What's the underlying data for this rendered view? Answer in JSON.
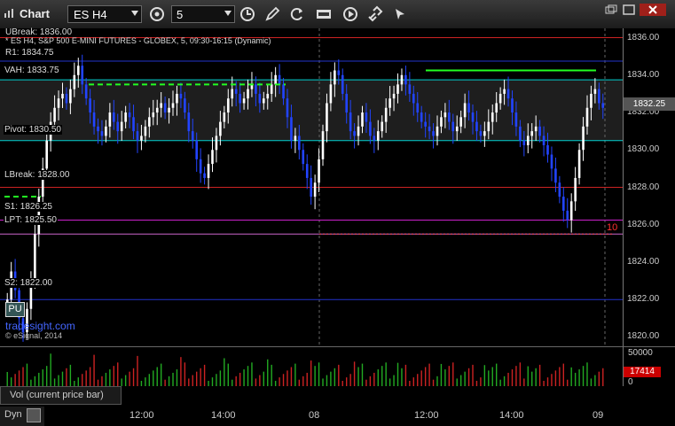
{
  "window": {
    "title": "Chart",
    "symbol": "ES H4",
    "interval": "5",
    "toolbar_icons": [
      "interval-menu-icon",
      "cursor-clock-icon",
      "draw-pencil-icon",
      "refresh-icon",
      "studies-icon",
      "play-icon",
      "link-icon"
    ],
    "window_icons": [
      "restore-icon",
      "maximize-icon",
      "close-icon"
    ]
  },
  "header": {
    "ubreak": "UBreak: 1836.00",
    "description": "* ES H4, S&P 500 E-MINI FUTURES - GLOBEX, 5, 09:30-16:15 (Dynamic)",
    "r1": "R1: 1834.75"
  },
  "levels": {
    "vah": "VAH: 1833.75",
    "pivot": "Pivot: 1830.50",
    "lbreak": "LBreak: 1828.00",
    "s1": "S1: 1826.25",
    "lpt": "LPT: 1825.50",
    "s2": "S2: 1822.00"
  },
  "badge": "PU",
  "watermark": "tradesight.com",
  "copyright": "© eSignal, 2014",
  "current_price": "1832.25",
  "volume": {
    "label": "Vol (current price bar)",
    "current": "17414",
    "tick_top": "50000",
    "tick_zero": "0"
  },
  "red_marker": "10",
  "footer": {
    "mode": "Dyn"
  },
  "colors": {
    "up_bar": "#ffffff",
    "down_bar": "#2244ff",
    "ubreak_line": "#cc2222",
    "r1_line": "#2233cc",
    "vah_line": "#00d0d0",
    "pivot_line": "#00d0d0",
    "lbreak_line": "#cc2222",
    "s1_line": "#cc22cc",
    "lpt_line": "#cc66cc",
    "s2_line": "#2233cc",
    "value_area_fill": "#1e1e1e",
    "volume_up": "#22aa22",
    "volume_down": "#cc2222"
  },
  "chart_data": {
    "type": "candlestick",
    "title": "ES H4, S&P 500 E-MINI FUTURES - GLOBEX, 5, 09:30-16:15 (Dynamic)",
    "ylim": [
      1819.5,
      1836.5
    ],
    "yticks": [
      "1836.00",
      "1834.00",
      "1832.00",
      "1830.00",
      "1828.00",
      "1826.00",
      "1824.00",
      "1822.00",
      "1820.00"
    ],
    "xticks": [
      "12:00",
      "14:00",
      "08",
      "12:00",
      "14:00",
      "09"
    ],
    "levels": [
      {
        "name": "UBreak",
        "value": 1836.0
      },
      {
        "name": "R1",
        "value": 1834.75
      },
      {
        "name": "VAH",
        "value": 1833.75
      },
      {
        "name": "Pivot",
        "value": 1830.5
      },
      {
        "name": "LBreak",
        "value": 1828.0
      },
      {
        "name": "S1",
        "value": 1826.25
      },
      {
        "name": "LPT",
        "value": 1825.5
      },
      {
        "name": "S2",
        "value": 1822.0
      }
    ],
    "closes": [
      1822.0,
      1823.5,
      1822.5,
      1821.0,
      1820.25,
      1821.5,
      1823.0,
      1825.5,
      1827.5,
      1829.0,
      1830.5,
      1831.5,
      1832.25,
      1832.75,
      1833.0,
      1832.5,
      1833.25,
      1834.0,
      1834.5,
      1833.5,
      1832.75,
      1832.0,
      1831.25,
      1831.0,
      1830.75,
      1831.25,
      1832.0,
      1831.5,
      1831.0,
      1831.5,
      1832.0,
      1831.75,
      1831.0,
      1830.5,
      1830.75,
      1831.25,
      1831.75,
      1832.0,
      1832.25,
      1832.5,
      1832.0,
      1832.25,
      1832.5,
      1833.0,
      1832.75,
      1832.0,
      1831.0,
      1830.5,
      1829.5,
      1828.75,
      1828.5,
      1829.25,
      1830.0,
      1830.75,
      1831.5,
      1832.0,
      1832.75,
      1833.25,
      1833.0,
      1832.5,
      1832.75,
      1833.25,
      1833.5,
      1833.0,
      1832.5,
      1832.75,
      1833.0,
      1833.5,
      1834.0,
      1833.5,
      1832.75,
      1831.75,
      1830.5,
      1830.75,
      1830.0,
      1829.25,
      1828.5,
      1827.5,
      1828.25,
      1829.5,
      1831.0,
      1832.5,
      1833.5,
      1834.25,
      1834.0,
      1833.0,
      1832.0,
      1831.0,
      1830.75,
      1831.25,
      1832.0,
      1831.5,
      1830.75,
      1830.5,
      1831.0,
      1831.5,
      1832.25,
      1832.75,
      1833.0,
      1833.5,
      1834.0,
      1833.5,
      1833.0,
      1832.5,
      1832.0,
      1831.5,
      1831.25,
      1831.0,
      1830.75,
      1831.25,
      1831.75,
      1832.0,
      1831.5,
      1831.0,
      1831.25,
      1831.75,
      1832.5,
      1832.0,
      1831.5,
      1831.0,
      1830.75,
      1831.0,
      1831.5,
      1832.0,
      1832.5,
      1833.0,
      1833.25,
      1832.75,
      1832.0,
      1831.25,
      1830.5,
      1830.25,
      1830.75,
      1831.0,
      1831.25,
      1830.75,
      1830.25,
      1829.75,
      1829.0,
      1828.25,
      1827.5,
      1826.75,
      1826.25,
      1827.25,
      1828.5,
      1830.0,
      1831.25,
      1832.25,
      1833.0,
      1833.25,
      1832.5,
      1832.25
    ],
    "volume_max": 50000
  }
}
